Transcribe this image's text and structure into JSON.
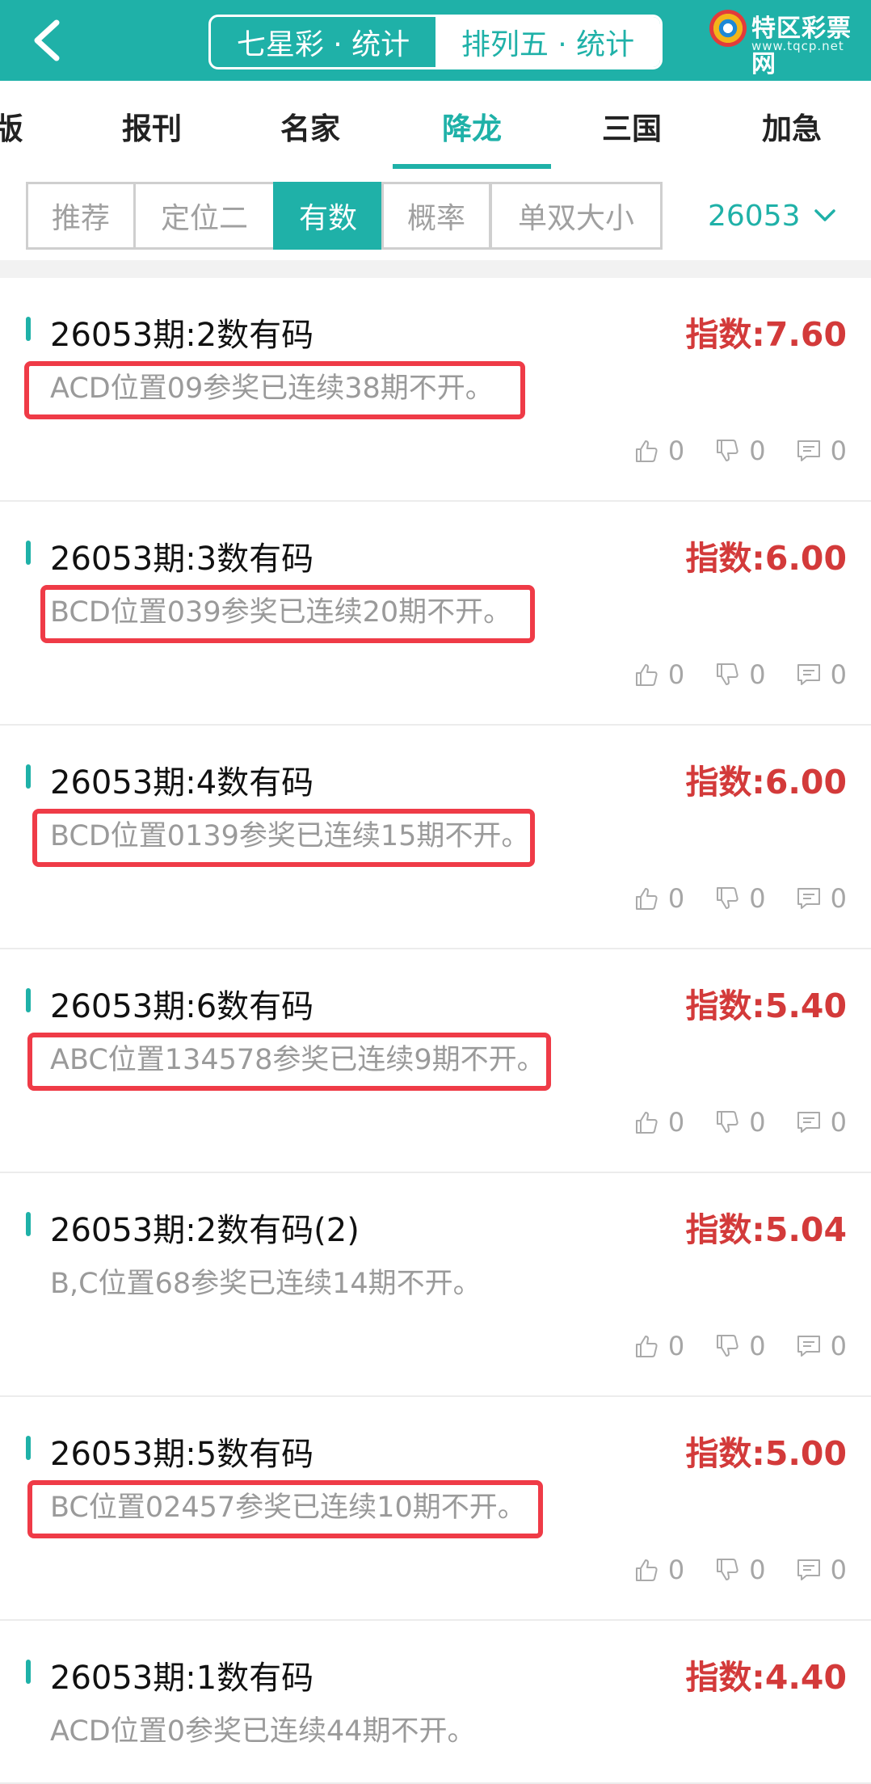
{
  "header": {
    "segments": [
      "七星彩 · 统计",
      "排列五 · 统计"
    ],
    "active_segment": 1,
    "logo_text": "特区彩票网",
    "logo_sub": "www.tqcp.net"
  },
  "nav": {
    "items": [
      "版",
      "报刊",
      "名家",
      "降龙",
      "三国",
      "加急"
    ],
    "active": "降龙"
  },
  "filters": {
    "items": [
      "推荐",
      "定位二",
      "有数",
      "概率",
      "单双大小"
    ],
    "active": "有数",
    "period": "26053"
  },
  "cards": [
    {
      "title": "26053期:2数有码",
      "index": "指数:7.60",
      "desc": "ACD位置09参奖已连续38期不开。",
      "likes": "0",
      "dislikes": "0",
      "comments": "0",
      "highlighted": true
    },
    {
      "title": "26053期:3数有码",
      "index": "指数:6.00",
      "desc": "BCD位置039参奖已连续20期不开。",
      "likes": "0",
      "dislikes": "0",
      "comments": "0",
      "highlighted": true
    },
    {
      "title": "26053期:4数有码",
      "index": "指数:6.00",
      "desc": "BCD位置0139参奖已连续15期不开。",
      "likes": "0",
      "dislikes": "0",
      "comments": "0",
      "highlighted": true
    },
    {
      "title": "26053期:6数有码",
      "index": "指数:5.40",
      "desc": "ABC位置134578参奖已连续9期不开。",
      "likes": "0",
      "dislikes": "0",
      "comments": "0",
      "highlighted": true
    },
    {
      "title": "26053期:2数有码(2)",
      "index": "指数:5.04",
      "desc": "B,C位置68参奖已连续14期不开。",
      "likes": "0",
      "dislikes": "0",
      "comments": "0",
      "highlighted": false
    },
    {
      "title": "26053期:5数有码",
      "index": "指数:5.00",
      "desc": "BC位置02457参奖已连续10期不开。",
      "likes": "0",
      "dislikes": "0",
      "comments": "0",
      "highlighted": true
    },
    {
      "title": "26053期:1数有码",
      "index": "指数:4.40",
      "desc": "ACD位置0参奖已连续44期不开。",
      "likes": "0",
      "dislikes": "0",
      "comments": "0",
      "highlighted": false
    }
  ],
  "colors": {
    "accent": "#1fb1a8",
    "index_red": "#d33a3a",
    "highlight": "#ef3b47"
  }
}
